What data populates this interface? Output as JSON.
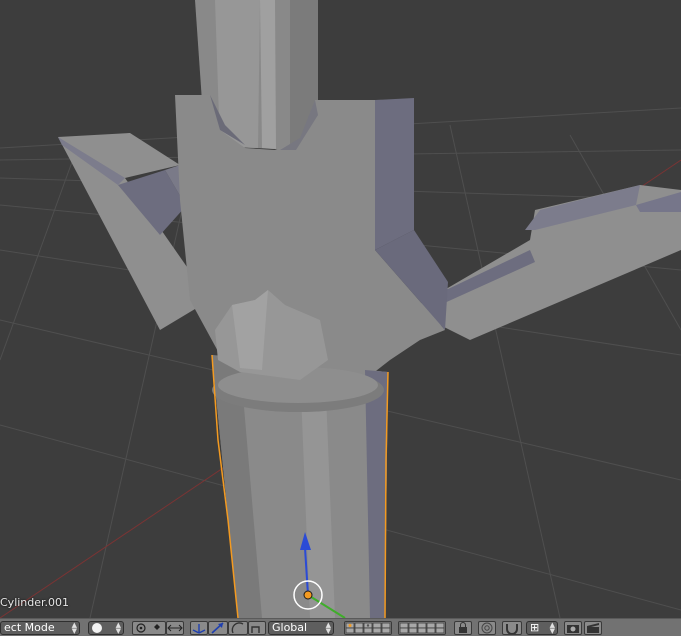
{
  "viewport": {
    "object_name": "Cylinder.001",
    "colors": {
      "background": "#3d3d3d",
      "grid": "#4f4f4f",
      "selection_outline": "#f39a21",
      "mesh_light": "#8f8f8f",
      "mesh_dark": "#6d6d7f",
      "axis_x": "#a03232",
      "axis_y": "#3f7a2a",
      "axis_z": "#2b4bd6"
    }
  },
  "header": {
    "mode_label": "ect Mode",
    "pivot_icon": "sphere-icon",
    "transform_orientation": "Global",
    "layer_count": 20,
    "icons": {
      "snap": "magnet-icon",
      "render": "camera-icon",
      "anim_render": "clapper-icon",
      "proportional": "proportional-icon",
      "manipulator": "axes-icon"
    }
  }
}
